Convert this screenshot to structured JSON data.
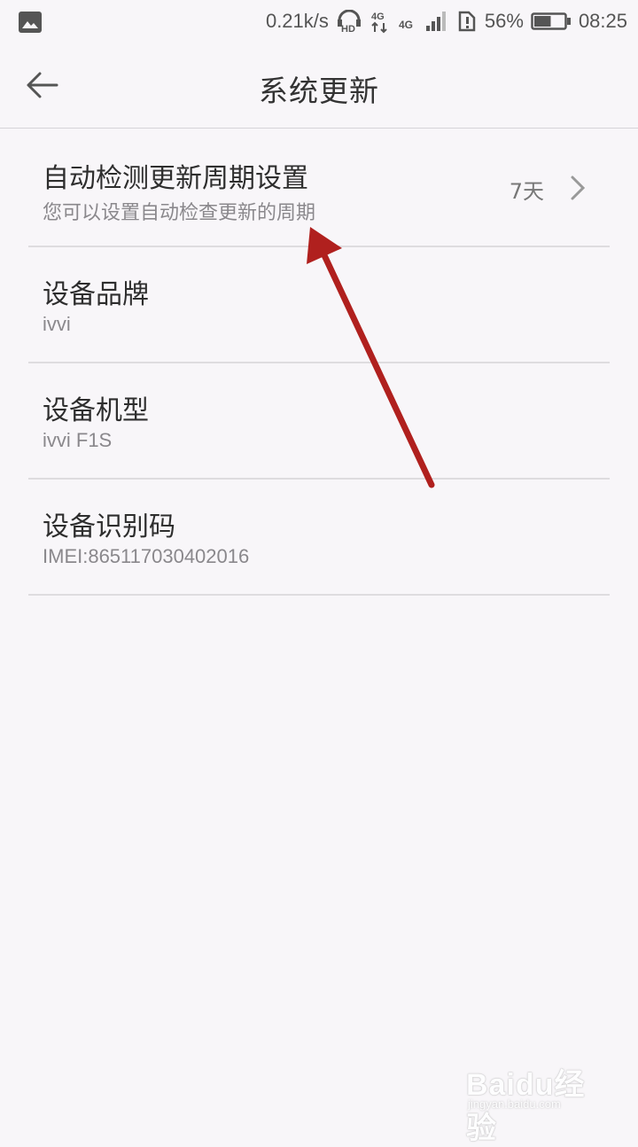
{
  "status_bar": {
    "left_icon": "image-icon",
    "speed": "0.21k/s",
    "hd_label": "HD",
    "network1": "4G",
    "network2": "4G",
    "battery_percent": "56%",
    "battery_level": 0.56,
    "time": "08:25"
  },
  "header": {
    "back_icon": "back-arrow-icon",
    "title": "系统更新"
  },
  "items": [
    {
      "title": "自动检测更新周期设置",
      "subtitle": "您可以设置自动检查更新的周期",
      "value": "7天",
      "has_chevron": true
    },
    {
      "title": "设备品牌",
      "subtitle": "ivvi"
    },
    {
      "title": "设备机型",
      "subtitle": "ivvi F1S"
    },
    {
      "title": "设备识别码",
      "subtitle": "IMEI:865117030402016"
    }
  ],
  "watermark": {
    "main": "Baidu经验",
    "sub": "jingyan.baidu.com"
  },
  "colors": {
    "background": "#f8f6f9",
    "divider": "#dedcdf",
    "annotation_arrow": "#b0201e"
  }
}
